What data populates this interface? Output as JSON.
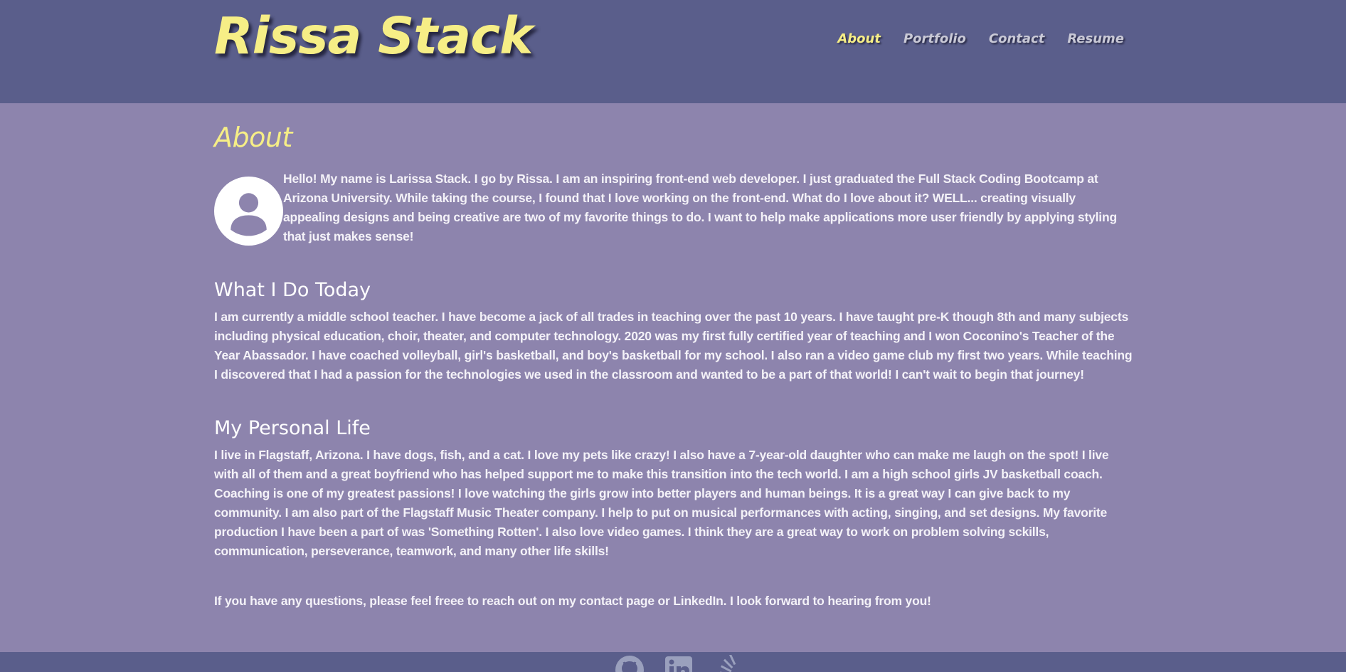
{
  "header": {
    "brand": "Rissa Stack",
    "nav": [
      {
        "label": "About",
        "active": true
      },
      {
        "label": "Portfolio",
        "active": false
      },
      {
        "label": "Contact",
        "active": false
      },
      {
        "label": "Resume",
        "active": false
      }
    ]
  },
  "about": {
    "title": "About",
    "avatar_icon": "user-avatar-icon",
    "intro": "Hello! My name is Larissa Stack. I go by Rissa. I am an inspiring front-end web developer. I just graduated the Full Stack Coding Bootcamp at Arizona University. While taking the course, I found that I love working on the front-end. What do I love about it? WELL... creating visually appealing designs and being creative are two of my favorite things to do. I want to help make applications more user friendly by applying styling that just makes sense!",
    "today_heading": "What I Do Today",
    "today_text": "I am currently a middle school teacher. I have become a jack of all trades in teaching over the past 10 years. I have taught pre-K though 8th and many subjects including physical education, choir, theater, and computer technology. 2020 was my first fully certified year of teaching and I won Coconino's Teacher of the Year Abassador. I have coached volleyball, girl's basketball, and boy's basketball for my school. I also ran a video game club my first two years. While teaching I discovered that I had a passion for the technologies we used in the classroom and wanted to be a part of that world! I can't wait to begin that journey!",
    "life_heading": "My Personal Life",
    "life_text": "I live in Flagstaff, Arizona. I have dogs, fish, and a cat. I love my pets like crazy! I also have a 7-year-old daughter who can make me laugh on the spot! I live with all of them and a great boyfriend who has helped support me to make this transition into the tech world. I am a high school girls JV basketball coach. Coaching is one of my greatest passions! I love watching the girls grow into better players and human beings. It is a great way I can give back to my community. I am also part of the Flagstaff Music Theater company. I help to put on musical performances with acting, singing, and set designs. My favorite production I have been a part of was 'Something Rotten'. I also love video games. I think they are a great way to work on problem solving sckills, communication, perseverance, teamwork, and many other life skills!",
    "closing": "If you have any questions, please feel freee to reach out on my contact page or LinkedIn. I look forward to hearing from you!"
  },
  "footer": {
    "icons": [
      "github-icon",
      "linkedin-icon",
      "stack-overflow-icon"
    ]
  },
  "colors": {
    "header_bg": "#5a5e8b",
    "page_bg": "#8d84ad",
    "accent": "#f6ee86",
    "nav_text": "#c9c9d6",
    "body_text": "#f4f2f8"
  }
}
